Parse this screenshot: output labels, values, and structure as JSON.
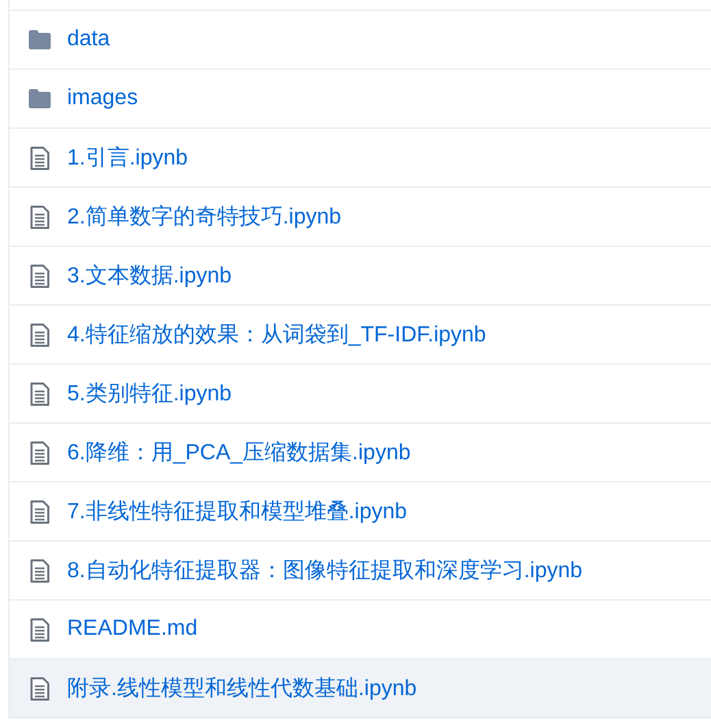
{
  "files": [
    {
      "kind": "folder",
      "name": "data",
      "highlighted": false
    },
    {
      "kind": "folder",
      "name": "images",
      "highlighted": false
    },
    {
      "kind": "file",
      "name": "1.引言.ipynb",
      "highlighted": false
    },
    {
      "kind": "file",
      "name": "2.简单数字的奇特技巧.ipynb",
      "highlighted": false
    },
    {
      "kind": "file",
      "name": "3.文本数据.ipynb",
      "highlighted": false
    },
    {
      "kind": "file",
      "name": "4.特征缩放的效果：从词袋到_TF-IDF.ipynb",
      "highlighted": false
    },
    {
      "kind": "file",
      "name": "5.类别特征.ipynb",
      "highlighted": false
    },
    {
      "kind": "file",
      "name": "6.降维：用_PCA_压缩数据集.ipynb",
      "highlighted": false
    },
    {
      "kind": "file",
      "name": "7.非线性特征提取和模型堆叠.ipynb",
      "highlighted": false
    },
    {
      "kind": "file",
      "name": "8.自动化特征提取器：图像特征提取和深度学习.ipynb",
      "highlighted": false
    },
    {
      "kind": "file",
      "name": "README.md",
      "highlighted": false
    },
    {
      "kind": "file",
      "name": "附录.线性模型和线性代数基础.ipynb",
      "highlighted": true
    }
  ]
}
